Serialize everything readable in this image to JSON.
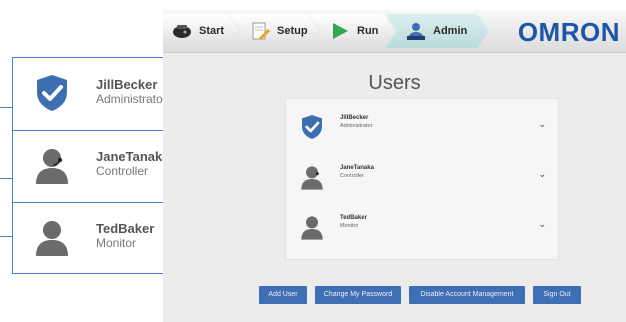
{
  "nav": {
    "steps": [
      {
        "label": "Start",
        "icon": "controller-icon"
      },
      {
        "label": "Setup",
        "icon": "setup-icon"
      },
      {
        "label": "Run",
        "icon": "play-icon"
      },
      {
        "label": "Admin",
        "icon": "users-icon"
      }
    ],
    "active_step": "Admin",
    "brand": "OMRON"
  },
  "page_title": "Users",
  "users": [
    {
      "name": "JillBecker",
      "role": "Administrator",
      "avatar": "shield-check-icon"
    },
    {
      "name": "JaneTanaka",
      "role": "Controller",
      "avatar": "user-headset-icon"
    },
    {
      "name": "TedBaker",
      "role": "Monitor",
      "avatar": "user-icon"
    }
  ],
  "expand_glyph": "⌄",
  "actions": {
    "add_user": "Add User",
    "change_password": "Change My Password",
    "disable_account_management": "Disable Account Management",
    "sign_out": "Sign Out"
  },
  "colors": {
    "brand_blue": "#1d55a8",
    "shield_blue": "#3d6fb0",
    "button_blue": "#3e6fb4",
    "active_tab": "#b9dcda",
    "run_green": "#2fa84f",
    "callout_border": "#3f7fc3"
  }
}
